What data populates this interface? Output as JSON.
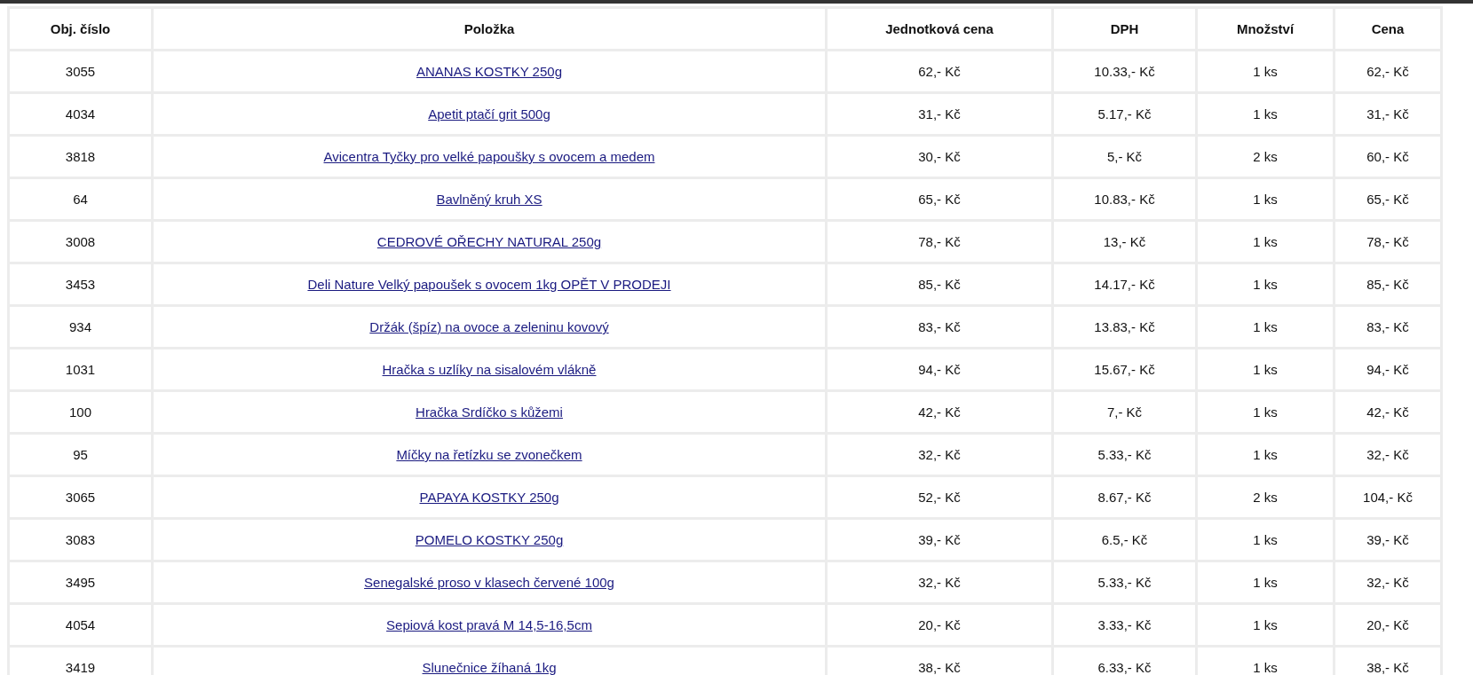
{
  "table": {
    "columns": [
      "Obj. číslo",
      "Položka",
      "Jednotková cena",
      "DPH",
      "Množství",
      "Cena"
    ],
    "rows": [
      {
        "number": "3055",
        "item": "ANANAS KOSTKY 250g",
        "unit_price": "62,- Kč",
        "vat": "10.33,- Kč",
        "quantity": "1 ks",
        "price": "62,- Kč"
      },
      {
        "number": "4034",
        "item": "Apetit ptačí grit 500g",
        "unit_price": "31,- Kč",
        "vat": "5.17,- Kč",
        "quantity": "1 ks",
        "price": "31,- Kč"
      },
      {
        "number": "3818",
        "item": "Avicentra Tyčky pro velké papoušky s ovocem a medem",
        "unit_price": "30,- Kč",
        "vat": "5,- Kč",
        "quantity": "2 ks",
        "price": "60,- Kč"
      },
      {
        "number": "64",
        "item": "Bavlněný kruh XS",
        "unit_price": "65,- Kč",
        "vat": "10.83,- Kč",
        "quantity": "1 ks",
        "price": "65,- Kč"
      },
      {
        "number": "3008",
        "item": "CEDROVÉ OŘECHY NATURAL 250g",
        "unit_price": "78,- Kč",
        "vat": "13,- Kč",
        "quantity": "1 ks",
        "price": "78,- Kč"
      },
      {
        "number": "3453",
        "item": "Deli Nature Velký papoušek s ovocem 1kg OPĚT V PRODEJI",
        "unit_price": "85,- Kč",
        "vat": "14.17,- Kč",
        "quantity": "1 ks",
        "price": "85,- Kč"
      },
      {
        "number": "934",
        "item": "Držák (špíz) na ovoce a zeleninu kovový",
        "unit_price": "83,- Kč",
        "vat": "13.83,- Kč",
        "quantity": "1 ks",
        "price": "83,- Kč"
      },
      {
        "number": "1031",
        "item": "Hračka s uzlíky na sisalovém vlákně",
        "unit_price": "94,- Kč",
        "vat": "15.67,- Kč",
        "quantity": "1 ks",
        "price": "94,- Kč"
      },
      {
        "number": "100",
        "item": "Hračka Srdíčko s kůžemi",
        "unit_price": "42,- Kč",
        "vat": "7,- Kč",
        "quantity": "1 ks",
        "price": "42,- Kč"
      },
      {
        "number": "95",
        "item": "Míčky na řetízku se zvonečkem",
        "unit_price": "32,- Kč",
        "vat": "5.33,- Kč",
        "quantity": "1 ks",
        "price": "32,- Kč"
      },
      {
        "number": "3065",
        "item": "PAPAYA KOSTKY 250g",
        "unit_price": "52,- Kč",
        "vat": "8.67,- Kč",
        "quantity": "2 ks",
        "price": "104,- Kč"
      },
      {
        "number": "3083",
        "item": "POMELO KOSTKY 250g",
        "unit_price": "39,- Kč",
        "vat": "6.5,- Kč",
        "quantity": "1 ks",
        "price": "39,- Kč"
      },
      {
        "number": "3495",
        "item": "Senegalské proso v klasech červené 100g",
        "unit_price": "32,- Kč",
        "vat": "5.33,- Kč",
        "quantity": "1 ks",
        "price": "32,- Kč"
      },
      {
        "number": "4054",
        "item": "Sepiová kost pravá M 14,5-16,5cm",
        "unit_price": "20,- Kč",
        "vat": "3.33,- Kč",
        "quantity": "1 ks",
        "price": "20,- Kč"
      },
      {
        "number": "3419",
        "item": "Slunečnice žíhaná 1kg",
        "unit_price": "38,- Kč",
        "vat": "6.33,- Kč",
        "quantity": "1 ks",
        "price": "38,- Kč"
      }
    ]
  }
}
